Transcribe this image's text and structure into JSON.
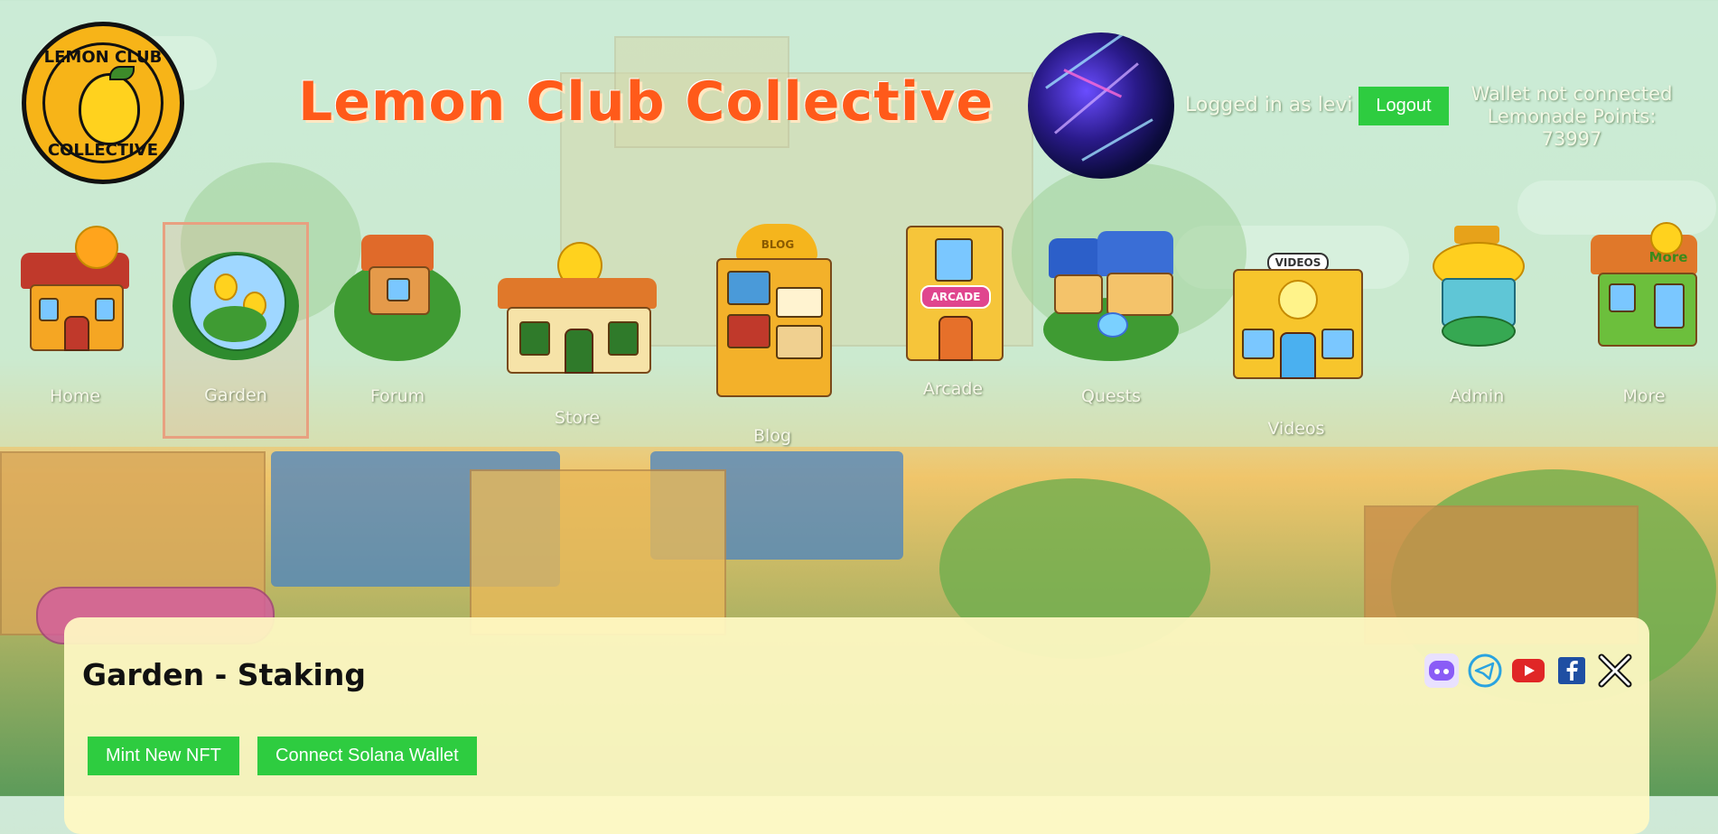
{
  "site": {
    "logo_top": "LEMON CLUB",
    "logo_bottom": "COLLECTIVE",
    "title": "Lemon Club Collective"
  },
  "user": {
    "logged_in_text": "Logged in as levi",
    "logout_label": "Logout",
    "wallet_status": "Wallet not connected",
    "points_text": "Lemonade Points: 73997"
  },
  "nav": {
    "items": [
      {
        "label": "Home",
        "icon": "home-house-icon"
      },
      {
        "label": "Garden",
        "icon": "garden-dome-icon",
        "active": true
      },
      {
        "label": "Forum",
        "icon": "treehouse-icon"
      },
      {
        "label": "Store",
        "icon": "store-icon"
      },
      {
        "label": "Blog",
        "icon": "blog-bookshelf-icon"
      },
      {
        "label": "Arcade",
        "icon": "arcade-building-icon"
      },
      {
        "label": "Quests",
        "icon": "quests-village-icon"
      },
      {
        "label": "Videos",
        "icon": "videos-theater-icon"
      },
      {
        "label": "Admin",
        "icon": "admin-tower-icon"
      },
      {
        "label": "More",
        "icon": "more-shop-icon"
      }
    ],
    "building_signs": {
      "blog": "BLOG",
      "arcade": "ARCADE",
      "videos": "VIDEOS",
      "more": "More"
    }
  },
  "page": {
    "title": "Garden - Staking",
    "actions": {
      "mint_label": "Mint New NFT",
      "connect_label": "Connect Solana Wallet"
    },
    "socials": [
      "discord-icon",
      "telegram-icon",
      "youtube-icon",
      "facebook-icon",
      "x-twitter-icon"
    ]
  },
  "colors": {
    "title_orange": "#ff5a1a",
    "button_green": "#2ecc40",
    "card_bg": "#fff9c4"
  }
}
